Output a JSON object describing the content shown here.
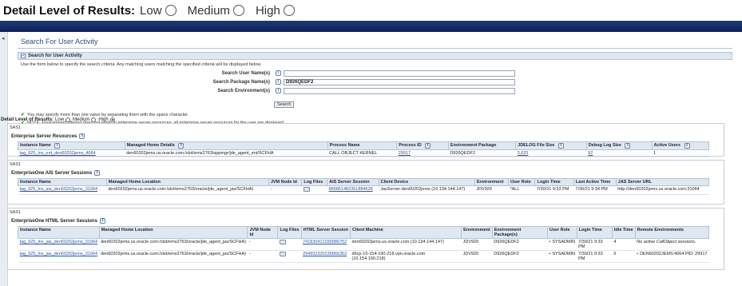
{
  "top": {
    "label": "Detail Level of Results:",
    "options": [
      "Low",
      "Medium",
      "High"
    ]
  },
  "page_title": "Search For User Activity",
  "search": {
    "section": "Search for User Activity",
    "desc": "Use the form below to specify the search criteria. Any matching users matching the specified criteria will be displayed below.",
    "fields": [
      {
        "label": "Search User Name(s)",
        "value": ""
      },
      {
        "label": "Search Package Name(s)",
        "value": "D926QEDF2"
      },
      {
        "label": "Search Environment(s)",
        "value": ""
      }
    ],
    "button": "Search",
    "notes": [
      "You may specify more than one value by separating them with the space character.",
      "NOTE: Environment filtering does not apply to enterprise server resources; all enterprise server resources for the user are displayed."
    ]
  },
  "detail2": {
    "label": "Detail Level of Results:",
    "options": [
      "Low",
      "Medium",
      "High"
    ],
    "selected": "High"
  },
  "panel1": {
    "sas": "SAS1",
    "title": "Enterprise Server Resources",
    "headers": [
      "Instance Name",
      "Managed Home Details",
      "Process Name",
      "Process ID",
      "Environment Package",
      "JDELOG File Size",
      "Debug Log Size",
      "Active Users"
    ],
    "rows": [
      [
        "tag_925_lnx_ent_den60202jems_4064",
        "den60202jems.us.oracle.com:/slot/ems2763/appmgr/jde_agent_ent/SCFHA",
        "CALL OBJECT KERNEL",
        "29917",
        "D926QEDF2",
        "3,625",
        "92",
        "1"
      ]
    ]
  },
  "panel2": {
    "sas": "SAS1",
    "title": "EnterpriseOne AIS Server Sessions",
    "headers": [
      "Instance Name",
      "Managed Home Location",
      "JVM Node Id",
      "Log Files",
      "AIS Server Session",
      "Client Device",
      "Environment",
      "User Role",
      "Login Time",
      "Last Active Time",
      "JAS Server URL"
    ],
    "rows": [
      [
        "tag_925_lnx_ais_den60202jems_31064",
        "den60202jems.us.oracle.com:/slot/ems2763/oracle/jde_agent_jas/SCFHA)",
        "-",
        "",
        "889851482351884628",
        "JasServer-den60202jems (10.134.144.147)",
        "JDV920",
        "*ALL",
        "7/30/21 9:33 PM",
        "7/30/21 9:34 PM",
        "http://den60202jems.us.oracle.com:31064"
      ]
    ]
  },
  "panel3": {
    "sas": "SAS1",
    "title": "EnterpriseOne HTML Server Sessions",
    "headers": [
      "Instance Name",
      "Managed Home Location",
      "JVM Node Id",
      "Log Files",
      "HTML Server Session",
      "Client Machine",
      "Environment",
      "Environment Package(s)",
      "User Role",
      "Login Time",
      "Idle Time",
      "Remote Environments"
    ],
    "rows": [
      [
        "tag_925_lnx_jas_den60202jems_31064",
        "den60202jems.us.oracle.com:/slot/ems2763/oracle/jde_agent_jas/SCFHA)",
        "-",
        "",
        "741830421030986752",
        "den60202jems.us.oracle.com (10.134.144.147)",
        "JDV920",
        "D926QEDF2",
        "SYSADMIN",
        "7/30/21 9:33 PM",
        "4",
        "No active CallObject sessions."
      ],
      [
        "tag_925_lnx_jas_den60202jems_31064",
        "den60202jems.us.oracle.com:/slot/ems2763/oracle/jde_agent_jas/SCFHA)",
        "-",
        "",
        "294952320236866352",
        "dhcp-10-154-190-218.vpn.oracle.com (10.154.190.218)",
        "JDV920",
        "D926QEDF2",
        "SYSADMIN",
        "7/30/21 9:33 PM",
        "6",
        "DEN60202JEMS:4064 PID: 29917"
      ]
    ]
  }
}
